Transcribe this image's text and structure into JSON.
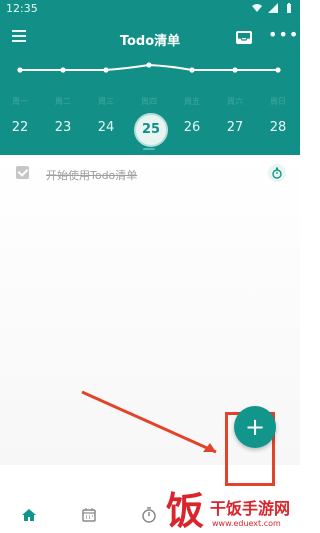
{
  "status_bar": {
    "time": "12:35"
  },
  "app_bar": {
    "title": "Todo清单",
    "more_label": "•••"
  },
  "colors": {
    "primary": "#128f86",
    "accent": "#12968c",
    "annotation": "#e1432b",
    "watermark": "#d9252b"
  },
  "week": {
    "weekdays": [
      "周一",
      "周二",
      "周三",
      "周四",
      "周五",
      "周六",
      "周日"
    ],
    "dates": [
      "22",
      "23",
      "24",
      "25",
      "26",
      "27",
      "28"
    ],
    "selected_index": 3
  },
  "tasks": [
    {
      "text": "开始使用Todo清单",
      "completed": true
    }
  ],
  "fab": {
    "label": "+"
  },
  "bottom_nav": {
    "items": [
      {
        "icon": "home-icon",
        "active": true
      },
      {
        "icon": "calendar-icon",
        "active": false
      },
      {
        "icon": "stopwatch-icon",
        "active": false
      }
    ]
  },
  "watermark": {
    "logo": "饭",
    "text": "干饭手游网",
    "url": "www.eduext.com"
  }
}
